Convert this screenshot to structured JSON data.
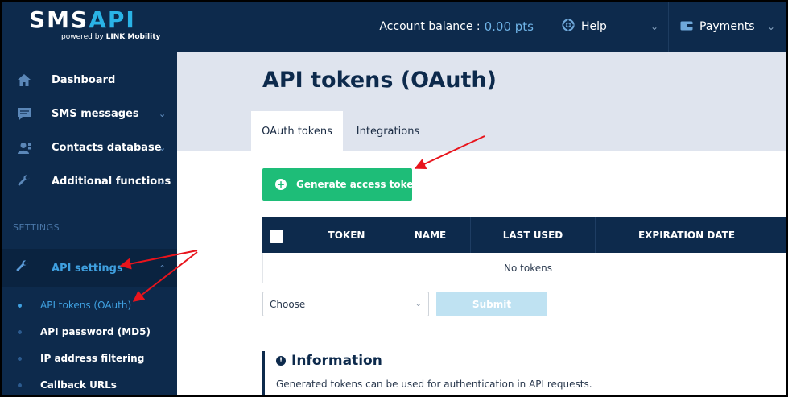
{
  "header": {
    "logo_text_a": "SMS",
    "logo_text_b": "API",
    "logo_sub_prefix": "powered by ",
    "logo_sub_brand": "LINK Mobility",
    "balance_label": "Account balance :",
    "balance_value": "0.00 pts",
    "help_label": "Help",
    "payments_label": "Payments"
  },
  "sidebar": {
    "items": [
      {
        "label": "Dashboard",
        "icon": "home-icon"
      },
      {
        "label": "SMS messages",
        "icon": "chat-icon"
      },
      {
        "label": "Contacts database",
        "icon": "contacts-icon"
      },
      {
        "label": "Additional functions",
        "icon": "wrench-icon"
      }
    ],
    "settings_heading": "SETTINGS",
    "api_settings_label": "API settings",
    "subitems": [
      {
        "label": "API tokens (OAuth)",
        "active": true
      },
      {
        "label": "API password (MD5)",
        "active": false
      },
      {
        "label": "IP address filtering",
        "active": false
      },
      {
        "label": "Callback URLs",
        "active": false
      }
    ]
  },
  "main": {
    "title": "API tokens (OAuth)",
    "tabs": [
      {
        "label": "OAuth tokens",
        "active": true
      },
      {
        "label": "Integrations",
        "active": false
      }
    ],
    "generate_button": "Generate access token",
    "table": {
      "columns": [
        "TOKEN",
        "NAME",
        "LAST USED",
        "EXPIRATION DATE"
      ],
      "empty_text": "No tokens"
    },
    "choose_placeholder": "Choose",
    "submit_label": "Submit",
    "info": {
      "title": "Information",
      "text": "Generated tokens can be used for authentication in API requests."
    }
  },
  "colors": {
    "navy": "#0d2a4c",
    "accent_blue": "#3fa0e0",
    "green": "#1ebd78",
    "annotation_red": "#e8141c"
  }
}
